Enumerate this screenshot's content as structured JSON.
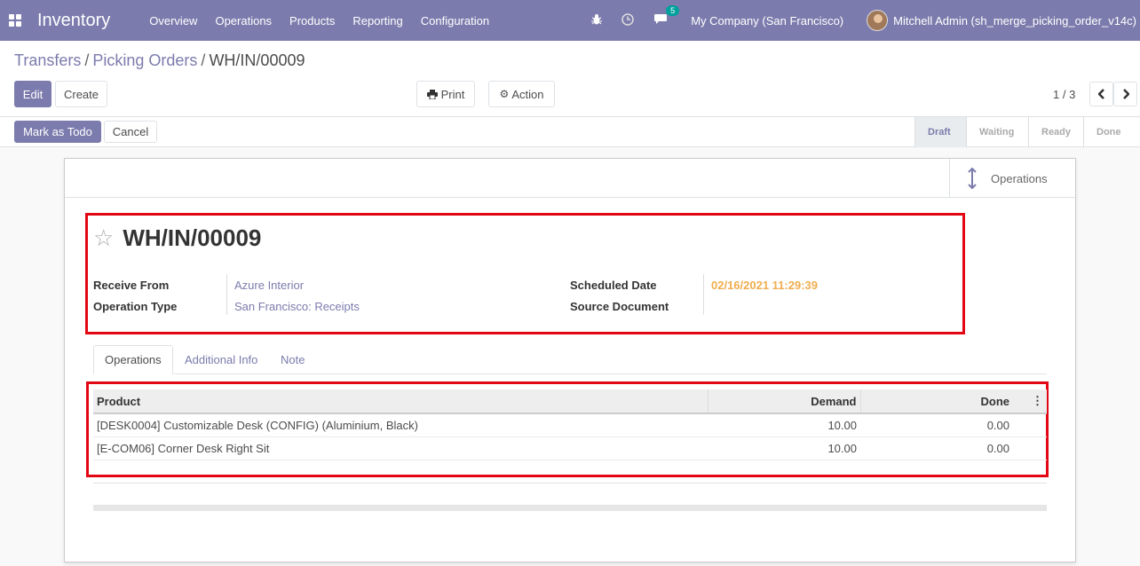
{
  "navbar": {
    "app_name": "Inventory",
    "menu": [
      "Overview",
      "Operations",
      "Products",
      "Reporting",
      "Configuration"
    ],
    "message_count": "5",
    "company": "My Company (San Francisco)",
    "user": "Mitchell Admin (sh_merge_picking_order_v14c)"
  },
  "breadcrumb": {
    "item1": "Transfers",
    "item2": "Picking Orders",
    "current": "WH/IN/00009",
    "separator": "/"
  },
  "buttons": {
    "edit": "Edit",
    "create": "Create",
    "print": "Print",
    "action": "Action",
    "mark_todo": "Mark as Todo",
    "cancel": "Cancel"
  },
  "pager": {
    "value": "1 / 3"
  },
  "status_steps": [
    "Draft",
    "Waiting",
    "Ready",
    "Done"
  ],
  "smart_button": {
    "label": "Operations"
  },
  "record": {
    "name": "WH/IN/00009",
    "receive_from_label": "Receive From",
    "receive_from": "Azure Interior",
    "operation_type_label": "Operation Type",
    "operation_type": "San Francisco: Receipts",
    "scheduled_date_label": "Scheduled Date",
    "scheduled_date": "02/16/2021 11:29:39",
    "source_document_label": "Source Document",
    "source_document": ""
  },
  "tabs": [
    "Operations",
    "Additional Info",
    "Note"
  ],
  "table": {
    "headers": [
      "Product",
      "Demand",
      "Done"
    ],
    "rows": [
      [
        "[DESK0004] Customizable Desk (CONFIG) (Aluminium, Black)",
        "10.00",
        "0.00"
      ],
      [
        "[E-COM06] Corner Desk Right Sit",
        "10.00",
        "0.00"
      ]
    ]
  },
  "colors": {
    "brand": "#7c7bad",
    "highlight": "#e30613",
    "date": "#f0ad4e"
  }
}
